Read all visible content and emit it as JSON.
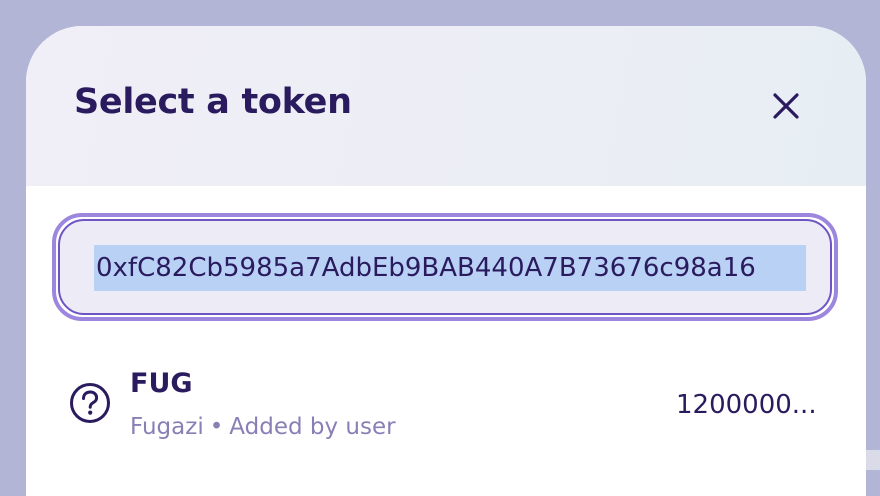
{
  "modal": {
    "title": "Select a token",
    "close_icon": "close-icon"
  },
  "search": {
    "value": "0xfC82Cb5985a7AdbEb9BAB440A7B73676c98a16",
    "selected": true
  },
  "token_list": [
    {
      "symbol": "FUG",
      "name": "Fugazi",
      "separator": "•",
      "note": "Added by user",
      "balance": "1200000...",
      "icon": "unknown-token-question-icon"
    }
  ],
  "colors": {
    "backdrop": "#b3b5d6",
    "title": "#2a1a5e",
    "input_border": "#9d86de",
    "input_background": "#edebf6",
    "selection_highlight": "#b8d1f5",
    "subtitle": "#8a7fb5"
  }
}
